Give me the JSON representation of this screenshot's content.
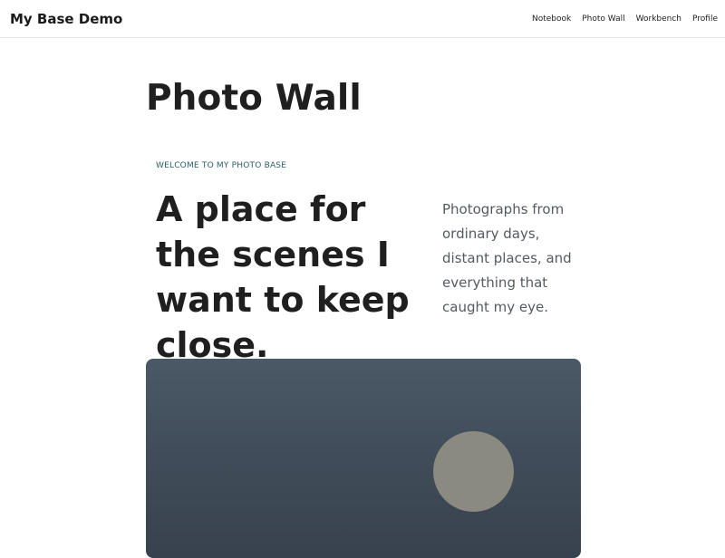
{
  "header": {
    "brand": "My Base Demo",
    "nav": [
      {
        "label": "Notebook"
      },
      {
        "label": "Photo Wall"
      },
      {
        "label": "Workbench"
      },
      {
        "label": "Profile"
      }
    ]
  },
  "page": {
    "title": "Photo Wall"
  },
  "intro": {
    "eyebrow": "WELCOME TO MY PHOTO BASE",
    "heading": "A place for the scenes I want to keep close.",
    "description": "Photographs from ordinary days, distant places, and everything that caught my eye."
  },
  "colors": {
    "eyebrow": "#2c5f66",
    "photo_sky_top": "#4b5967",
    "photo_sky_bottom": "#38424e",
    "photo_moon": "#8a8a80"
  }
}
